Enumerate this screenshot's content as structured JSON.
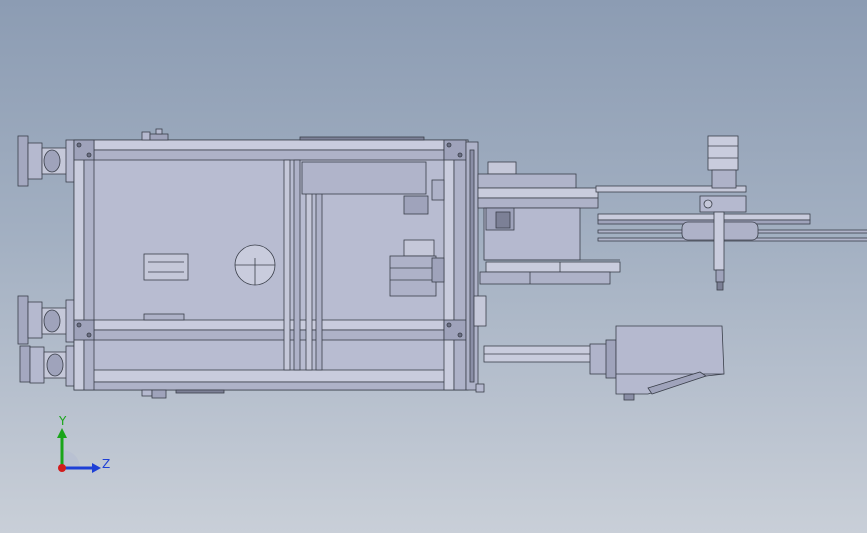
{
  "viewport": {
    "background_top": "#8c9cb3",
    "background_bottom": "#c9cfd8"
  },
  "model": {
    "line_color": "#3a3f4a",
    "face_color": "#b5b9cf",
    "face_dark": "#9fa3bb",
    "face_light": "#cdd0e0"
  },
  "triad": {
    "y_label": "Y",
    "z_label": "Z",
    "y_color": "#1aa51a",
    "z_color": "#1d3fd6",
    "x_color": "#d21c1c"
  }
}
